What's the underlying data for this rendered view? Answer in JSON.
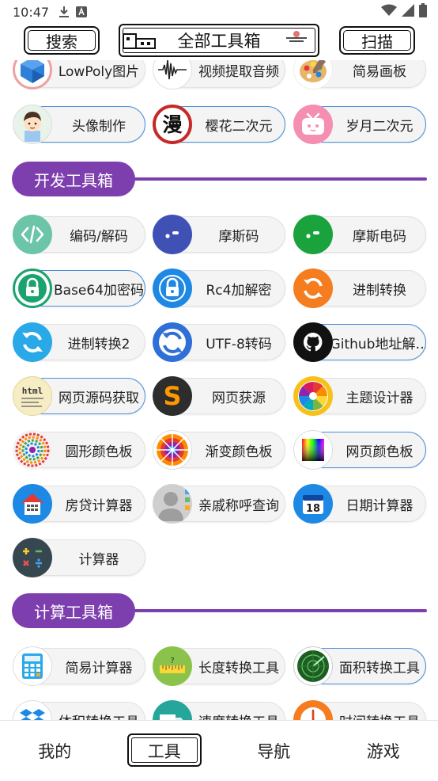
{
  "status_bar": {
    "time": "10:47",
    "icons": [
      "download-icon",
      "text-a-icon",
      "wifi-icon",
      "signal-icon",
      "battery-icon"
    ]
  },
  "toolbar": {
    "search_label": "搜索",
    "title": "全部工具箱",
    "scan_label": "扫描"
  },
  "rows_top": [
    [
      {
        "label": "LowPoly图片",
        "icon": "lowpoly-gem-icon",
        "color": "#2f7fd8"
      },
      {
        "label": "视频提取音频",
        "icon": "audio-wave-icon",
        "color": "#222222"
      },
      {
        "label": "简易画板",
        "icon": "palette-icon",
        "color": "#e8a23a"
      }
    ],
    [
      {
        "label": "头像制作",
        "icon": "avatar-boy-icon",
        "color": "#9cc7f0",
        "highlight": true
      },
      {
        "label": "樱花二次元",
        "icon": "manga-icon",
        "color": "#c62828",
        "highlight": true
      },
      {
        "label": "岁月二次元",
        "icon": "bilibili-tv-icon",
        "color": "#f48fb1",
        "highlight": true
      }
    ]
  ],
  "sections": [
    {
      "title": "开发工具箱",
      "rows": [
        [
          {
            "label": "编码/解码",
            "icon": "code-icon",
            "color": "#6cc4a9"
          },
          {
            "label": "摩斯码",
            "icon": "morse-icon",
            "color": "#3f51b5"
          },
          {
            "label": "摩斯电码",
            "icon": "morse-dot-icon",
            "color": "#1aa33c"
          }
        ],
        [
          {
            "label": "Base64加密码",
            "icon": "lock-green-icon",
            "color": "#1aa36c",
            "highlight": true
          },
          {
            "label": "Rc4加解密",
            "icon": "lock-blue-icon",
            "color": "#1e88e5"
          },
          {
            "label": "进制转换",
            "icon": "refresh-orange-icon",
            "color": "#f57c1f"
          }
        ],
        [
          {
            "label": "进制转换2",
            "icon": "refresh-cyan-icon",
            "color": "#29a9e8"
          },
          {
            "label": "UTF-8转码",
            "icon": "refresh-blue-icon",
            "color": "#2f6fd8"
          },
          {
            "label": "Github地址解…",
            "icon": "github-icon",
            "color": "#111111",
            "highlight": true
          }
        ],
        [
          {
            "label": "网页源码获取",
            "icon": "html-icon",
            "color": "#f5e6a8",
            "highlight": true
          },
          {
            "label": "网页获源",
            "icon": "sublime-s-icon",
            "color": "#2d2d2d"
          },
          {
            "label": "主题设计器",
            "icon": "color-wheel-icon",
            "color": "#f7c11a"
          }
        ],
        [
          {
            "label": "圆形颜色板",
            "icon": "circle-palette-icon",
            "color": "#e0e0e0"
          },
          {
            "label": "渐变颜色板",
            "icon": "gradient-wheel-icon",
            "color": "#ff9800"
          },
          {
            "label": "网页颜色板",
            "icon": "web-palette-icon",
            "color": "#f5f5f5",
            "highlight": true
          }
        ],
        [
          {
            "label": "房贷计算器",
            "icon": "house-icon",
            "color": "#1e88e5"
          },
          {
            "label": "亲戚称呼查询",
            "icon": "person-icon",
            "color": "#9e9e9e"
          },
          {
            "label": "日期计算器",
            "icon": "calendar-icon",
            "color": "#1e88e5"
          }
        ],
        [
          {
            "label": "计算器",
            "icon": "calc-keys-icon",
            "color": "#37474f"
          }
        ]
      ]
    },
    {
      "title": "计算工具箱",
      "rows": [
        [
          {
            "label": "简易计算器",
            "icon": "calculator-icon",
            "color": "#29a9e8"
          },
          {
            "label": "长度转换工具",
            "icon": "ruler-icon",
            "color": "#8bc34a"
          },
          {
            "label": "面积转换工具",
            "icon": "radar-icon",
            "color": "#1b5e20",
            "highlight": true
          }
        ],
        [
          {
            "label": "体积转换工具",
            "icon": "dropbox-icon",
            "color": "#1e88e5"
          },
          {
            "label": "速度转换工具",
            "icon": "truck-icon",
            "color": "#26a69a"
          },
          {
            "label": "时间转换工具",
            "icon": "clock-icon",
            "color": "#f57c1f"
          }
        ]
      ]
    }
  ],
  "bottom_nav": [
    {
      "label": "我的",
      "active": false
    },
    {
      "label": "工具",
      "active": true
    },
    {
      "label": "导航",
      "active": false
    },
    {
      "label": "游戏",
      "active": false
    }
  ]
}
